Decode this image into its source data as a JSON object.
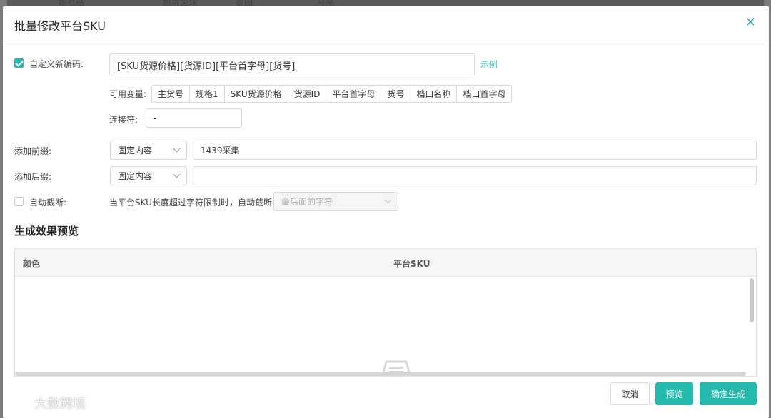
{
  "background": {
    "tabs": [
      "跟数据",
      "跨境全球",
      "泰国",
      "马来"
    ]
  },
  "modal": {
    "title": "批量修改平台SKU",
    "close_icon": "close-icon"
  },
  "custom_code": {
    "checked": true,
    "label": "自定义新编码:",
    "value": "[SKU货源价格][货源ID][平台首字母][货号]",
    "example_link": "示例",
    "variables_label": "可用变量:",
    "variables": [
      "主货号",
      "规格1",
      "SKU货源价格",
      "货源ID",
      "平台首字母",
      "货号",
      "档口名称",
      "档口首字母"
    ],
    "connector_label": "连接符:",
    "connector_value": "-"
  },
  "prefix": {
    "label": "添加前缀:",
    "mode": "固定内容",
    "value": "1439采集"
  },
  "suffix": {
    "label": "添加后缀:",
    "mode": "固定内容",
    "value": ""
  },
  "auto_truncate": {
    "checked": false,
    "label": "自动截断:",
    "description": "当平台SKU长度超过字符限制时，自动截断",
    "option": "最后面的字符"
  },
  "preview": {
    "title": "生成效果预览",
    "columns": [
      "颜色",
      "平台SKU"
    ]
  },
  "footer": {
    "cancel": "取消",
    "preview": "预览",
    "confirm": "确定生成"
  },
  "watermark": {
    "text": "大数跨境"
  },
  "colors": {
    "accent": "#2ab5b0",
    "primary_button": "#25b8ad"
  }
}
